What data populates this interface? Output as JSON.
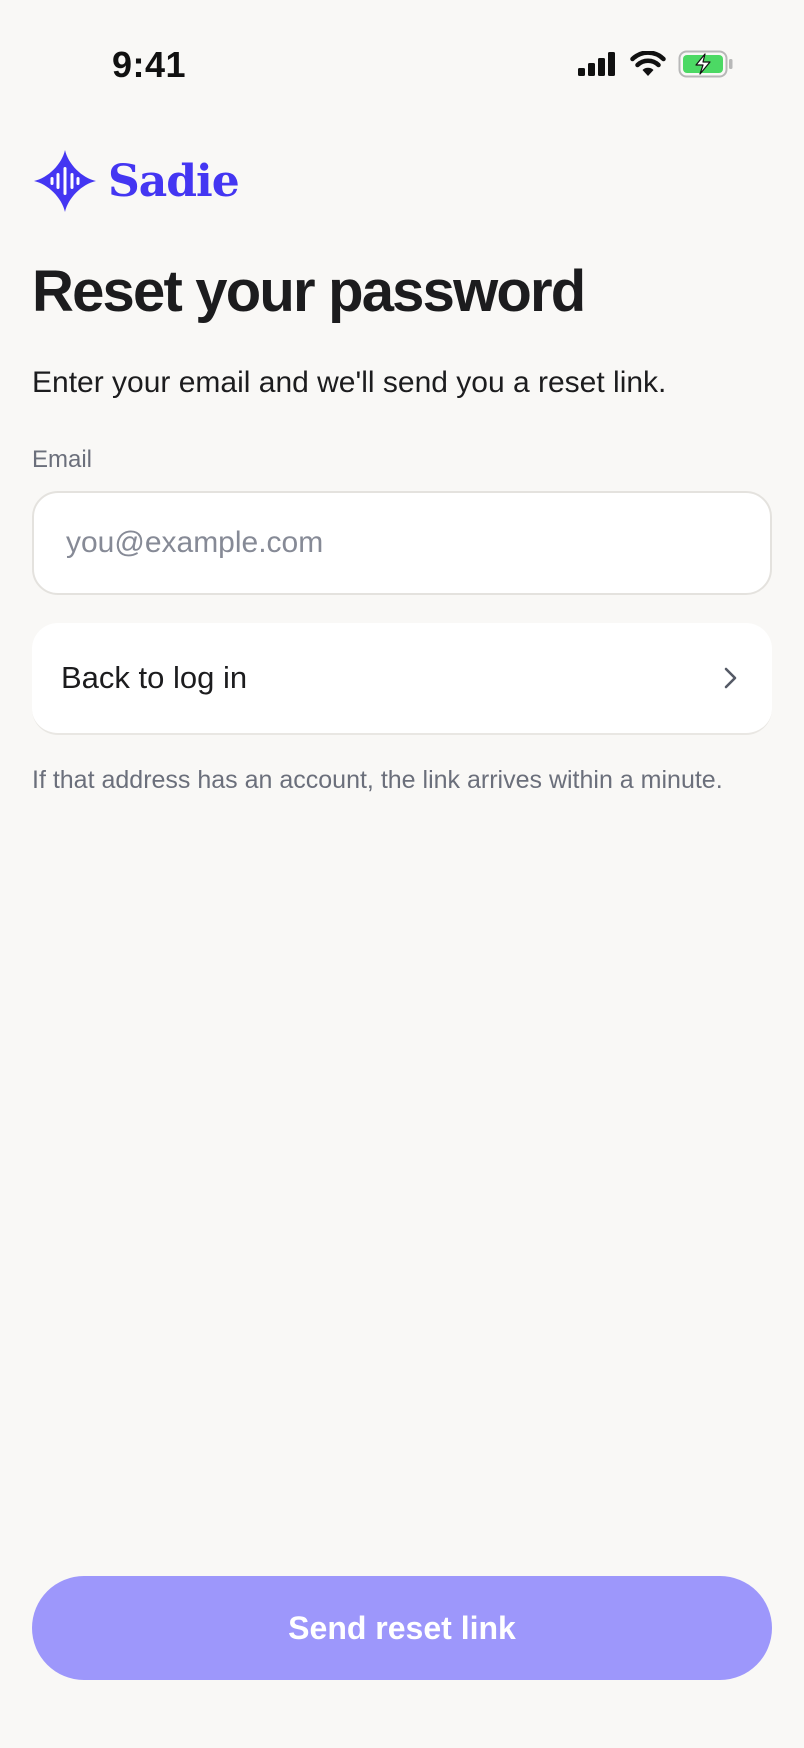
{
  "status_bar": {
    "time": "9:41",
    "icons": [
      "cellular-signal-icon",
      "wifi-icon",
      "battery-charging-icon"
    ]
  },
  "brand": {
    "name": "Sadie",
    "logo_icon": "waveform-diamond-icon",
    "color": "#4436f2"
  },
  "page": {
    "title": "Reset your password",
    "subtitle": "Enter your email and we'll send you a reset link."
  },
  "form": {
    "email_label": "Email",
    "email_value": "",
    "email_placeholder": "you@example.com"
  },
  "back_link": {
    "label": "Back to log in",
    "icon": "chevron-right-icon"
  },
  "helper_text": "If that address has an account, the link arrives within a minute.",
  "primary_button": {
    "label": "Send reset link",
    "state": "disabled",
    "color": "#9d97fb"
  },
  "colors": {
    "background": "#f9f8f6",
    "text": "#1c1c1e",
    "muted_text": "#6b6f7b",
    "battery_green": "#4cd964"
  }
}
